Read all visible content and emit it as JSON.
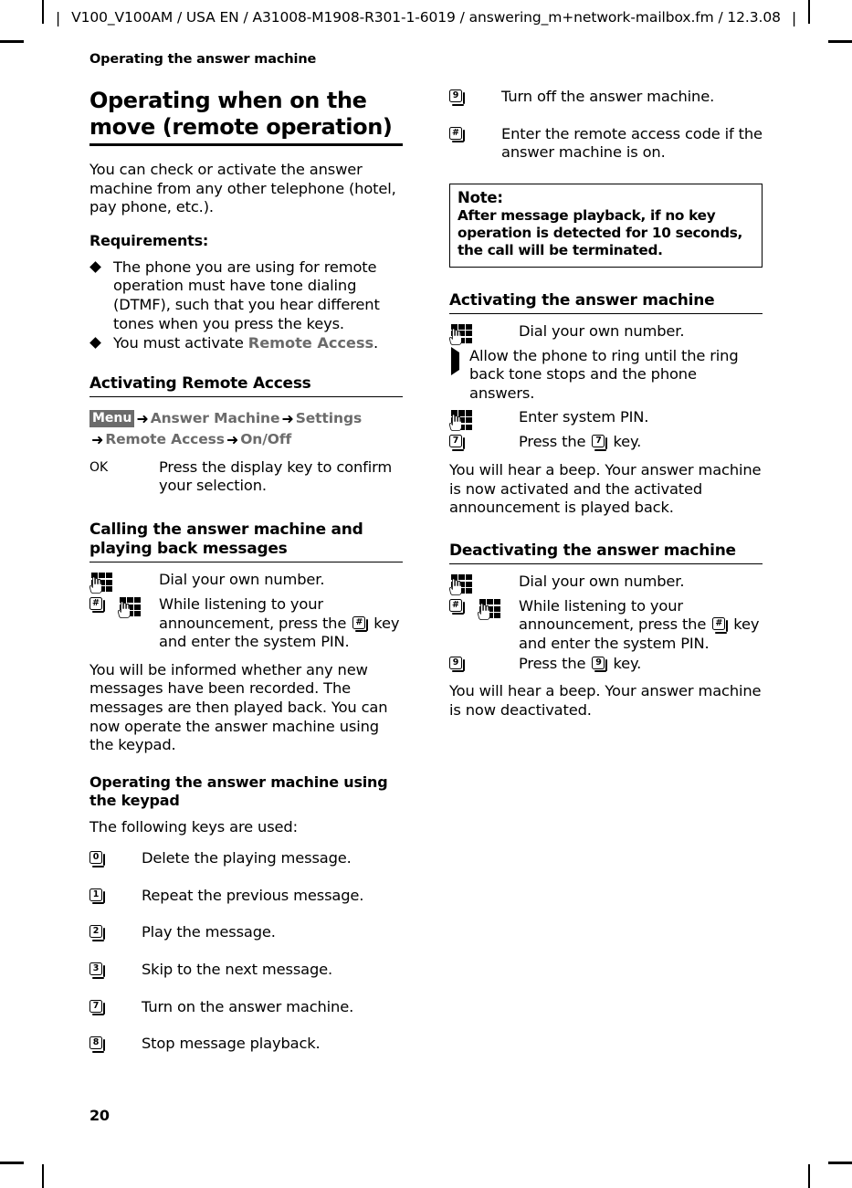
{
  "header": {
    "text": "V100_V100AM / USA EN / A31008-M1908-R301-1-6019 / answering_m+network-mailbox.fm / 12.3.08",
    "bar_left": "|",
    "bar_right": "|"
  },
  "running_title": "Operating the answer machine",
  "folio": "20",
  "left_column": {
    "chapter_title": "Operating when on the move (remote operation)",
    "intro": "You can check or activate the answer machine from any other telephone (hotel, pay phone, etc.).",
    "requirements_heading": "Requirements:",
    "requirements": [
      {
        "text_before": "The phone you are using for remote operation must have tone dialing (DTMF), such that you hear different tones when you press the keys.",
        "term": "",
        "text_after": ""
      },
      {
        "text_before": "You must activate ",
        "term": "Remote Access",
        "text_after": "."
      }
    ],
    "activating_remote_access": {
      "heading": "Activating Remote Access",
      "menu_path": {
        "display_key": "Menu",
        "arrow": "➜",
        "items": [
          "Answer Machine",
          "Settings",
          "Remote Access",
          "On/Off"
        ]
      },
      "confirm_step": {
        "key_label": "OK",
        "text": "Press the display key to confirm your selection."
      }
    },
    "calling": {
      "heading": "Calling the answer machine and playing back messages",
      "steps": [
        {
          "icons": [
            "keypad"
          ],
          "text": "Dial your own number."
        },
        {
          "icons": [
            "key:#",
            "keypad"
          ],
          "text_1": "While listening to your announcement, press the ",
          "inline_key": "#",
          "text_2": " key and enter the system PIN."
        }
      ],
      "paragraph": "You will be informed whether any new messages have been recorded. The messages are then played back. You can now operate the answer machine using the keypad."
    },
    "keypad_section": {
      "heading": "Operating the answer machine using the keypad",
      "intro": "The following keys are used:",
      "keys": [
        {
          "key": "0",
          "text": "Delete the playing message."
        },
        {
          "key": "1",
          "text": "Repeat the previous message."
        },
        {
          "key": "2",
          "text": "Play the message."
        },
        {
          "key": "3",
          "text": "Skip to the next message."
        },
        {
          "key": "7",
          "text": "Turn on the answer machine."
        },
        {
          "key": "8",
          "text": "Stop message playback."
        }
      ]
    }
  },
  "right_column": {
    "keys_continued": [
      {
        "key": "9",
        "text": "Turn off the answer machine."
      },
      {
        "key": "#",
        "text": "Enter the remote access code if the answer machine is on."
      }
    ],
    "note": {
      "title": "Note:",
      "body": "After message playback, if no key operation is detected for 10 seconds, the call will be terminated."
    },
    "activating": {
      "heading": "Activating the answer machine",
      "step_dial": {
        "icons": [
          "keypad"
        ],
        "text": "Dial your own number."
      },
      "step_arrow": "Allow the phone to ring until the ring back tone stops and the phone answers.",
      "step_pin": {
        "icons": [
          "keypad"
        ],
        "text": "Enter system PIN."
      },
      "step_press": {
        "key": "7",
        "text_1": "Press the ",
        "inline_key": "7",
        "text_2": " key."
      },
      "paragraph": "You will hear a beep. Your answer machine is now activated and the activated announcement is played back."
    },
    "deactivating": {
      "heading": "Deactivating the answer machine",
      "step_dial": {
        "icons": [
          "keypad"
        ],
        "text": "Dial your own number."
      },
      "step_hash": {
        "icons": [
          "key:#",
          "keypad"
        ],
        "text_1": "While listening to your announcement, press the ",
        "inline_key": "#",
        "text_2": " key and enter the system PIN."
      },
      "step_press": {
        "key": "9",
        "text_1": "Press the ",
        "inline_key": "9",
        "text_2": " key."
      },
      "paragraph": "You will hear a beep. Your answer machine is now deactivated."
    }
  },
  "colors": {
    "ui_term_gray": "#6b6b6b",
    "text_black": "#000000",
    "page_white": "#ffffff"
  }
}
